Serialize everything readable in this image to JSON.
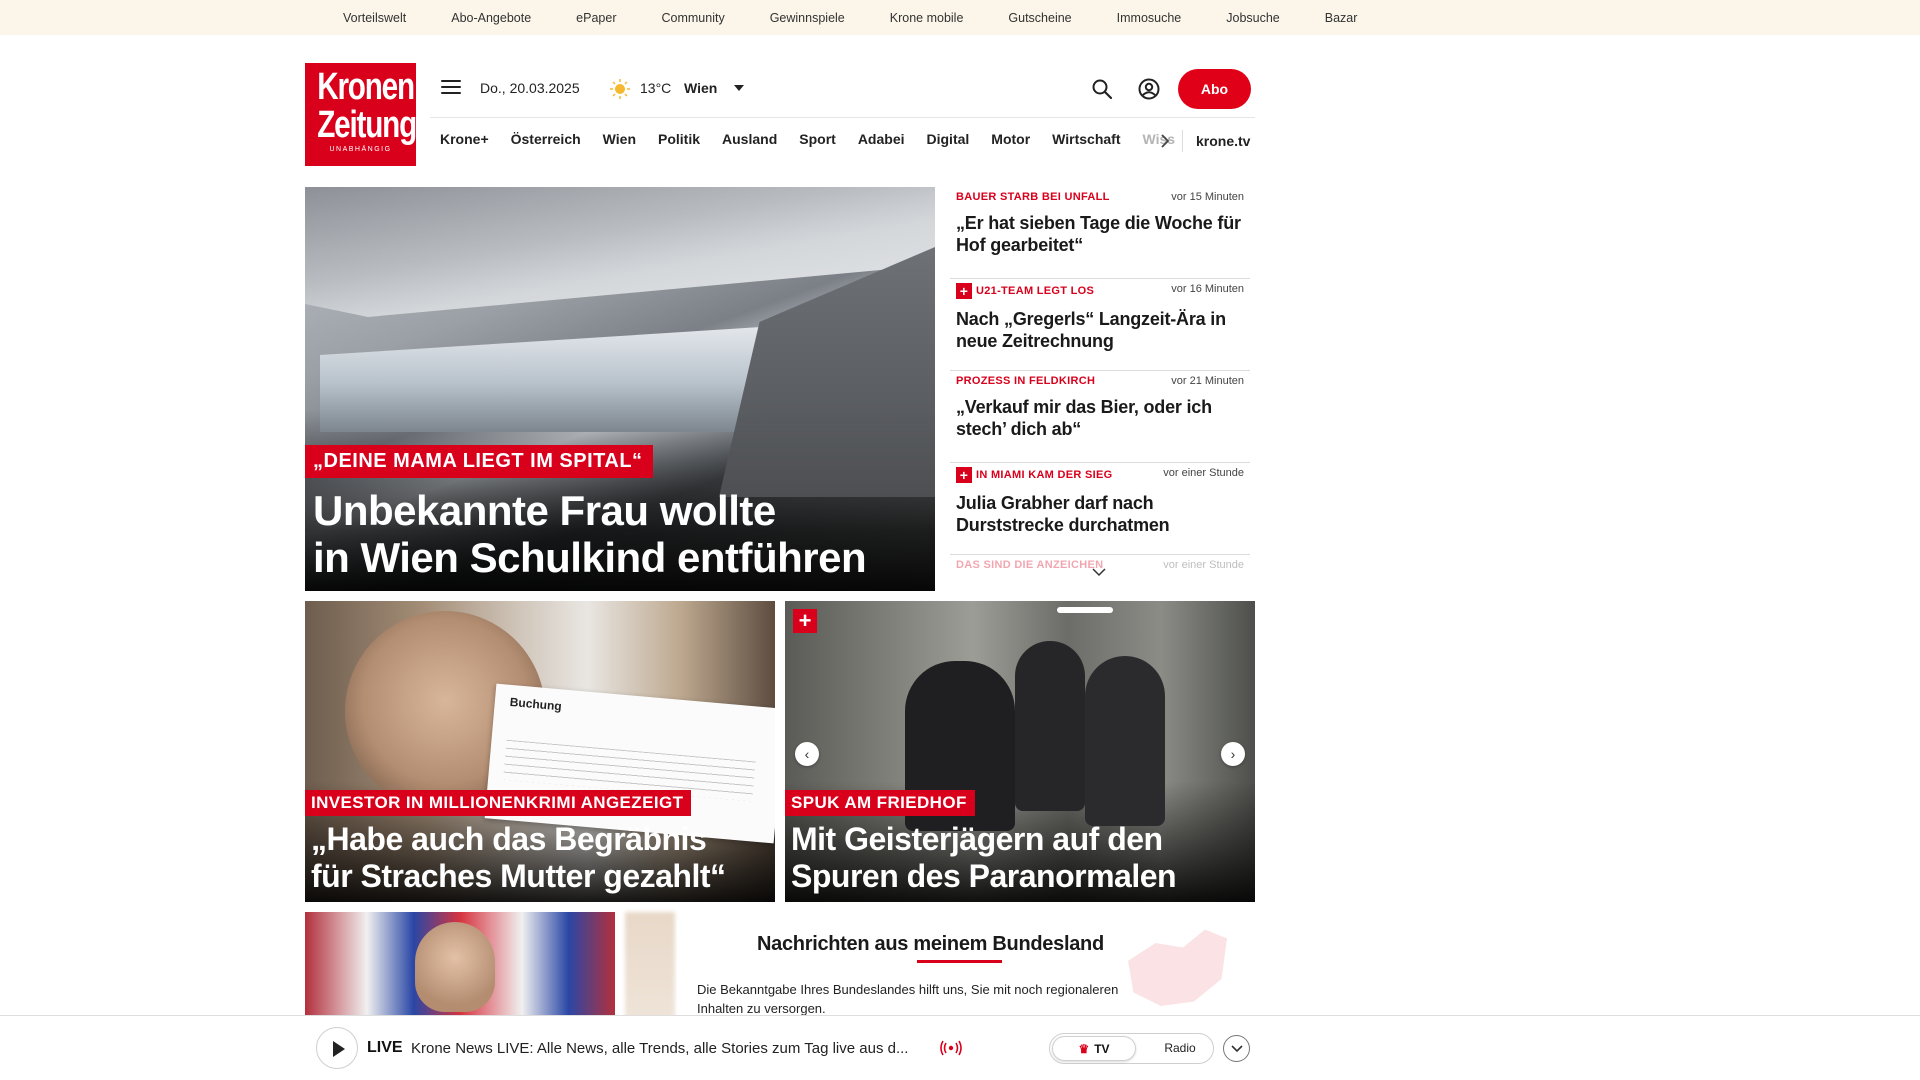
{
  "topbar": {
    "links": [
      "Vorteilswelt",
      "Abo-Angebote",
      "ePaper",
      "Community",
      "Gewinnspiele",
      "Krone mobile",
      "Gutscheine",
      "Immosuche",
      "Jobsuche",
      "Bazar"
    ]
  },
  "header": {
    "logo_line1": "Kronen",
    "logo_line2": "Zeitung",
    "logo_tagline": "UNABHÄNGIG",
    "date": "Do., 20.03.2025",
    "temperature": "13°C",
    "city": "Wien",
    "abo_label": "Abo"
  },
  "nav": {
    "items": [
      "Krone+",
      "Österreich",
      "Wien",
      "Politik",
      "Ausland",
      "Sport",
      "Adabei",
      "Digital",
      "Motor",
      "Wirtschaft"
    ],
    "faded_item": "Wiss",
    "krone_tv": "krone.tv"
  },
  "hero": {
    "kicker": "„DEINE MAMA LIEGT IM SPITAL“",
    "title_line1": "Unbekannte Frau wollte",
    "title_line2": "in Wien Schulkind entführen"
  },
  "side_list": [
    {
      "kicker": "BAUER STARB BEI UNFALL",
      "time": "vor 15 Minuten",
      "title": "„Er hat sieben Tage die Woche für Hof gearbeitet“",
      "plus": false
    },
    {
      "kicker": "U21-TEAM LEGT LOS",
      "time": "vor 16 Minuten",
      "title": "Nach „Gregerls“ Langzeit-Ära in neue Zeitrechnung",
      "plus": true
    },
    {
      "kicker": "PROZESS IN FELDKIRCH",
      "time": "vor 21 Minuten",
      "title": "„Verkauf mir das Bier, oder ich stech’ dich ab“",
      "plus": false
    },
    {
      "kicker": "IN MIAMI KAM DER SIEG",
      "time": "vor einer Stunde",
      "title": "Julia Grabher darf nach Durststrecke durchatmen",
      "plus": true
    },
    {
      "kicker": "DAS SIND DIE ANZEICHEN",
      "time": "vor einer Stunde",
      "title": "",
      "plus": false
    }
  ],
  "cards": [
    {
      "kicker": "INVESTOR IN MILLIONENKRIMI ANGEZEIGT",
      "title_line1": "„Habe auch das Begräbnis",
      "title_line2": "für Straches Mutter gezahlt“",
      "doc_title": "Buchung"
    },
    {
      "kicker": "SPUK AM FRIEDHOF",
      "title_line1": "Mit Geisterjägern auf den",
      "title_line2": "Spuren des Paranormalen"
    }
  ],
  "bundesland": {
    "title": "Nachrichten aus meinem Bundesland",
    "text": "Die Bekanntgabe Ihres Bundeslandes hilft uns, Sie mit noch regionaleren Inhalten zu versorgen."
  },
  "livebar": {
    "live_label": "LIVE",
    "text": "Krone News LIVE: Alle News, alle Trends, alle Stories zum Tag live aus d...",
    "tv_label": "TV",
    "radio_label": "Radio"
  },
  "colors": {
    "brand_red": "#d9001c",
    "topbar_bg": "#fbf6e9"
  }
}
